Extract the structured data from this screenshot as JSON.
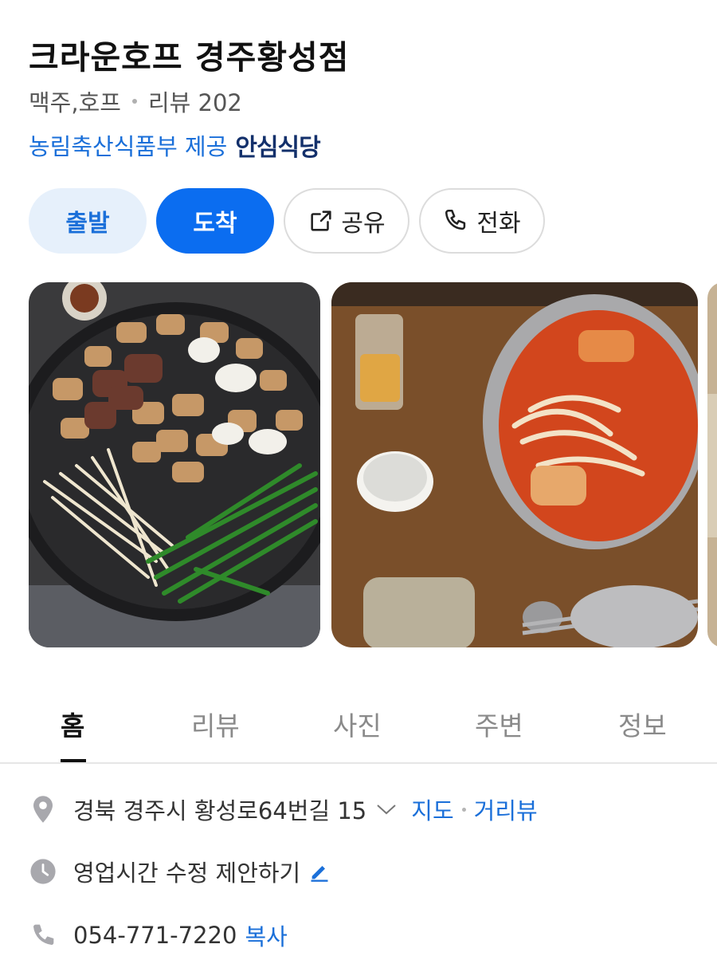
{
  "place": {
    "name": "크라운호프 경주황성점",
    "category": "맥주,호프",
    "review_label": "리뷰 202",
    "gov_provider": "농림축산식품부 제공",
    "gov_badge": "안심식당"
  },
  "actions": {
    "depart": "출발",
    "arrive": "도착",
    "share": "공유",
    "call": "전화"
  },
  "tabs": [
    {
      "label": "홈",
      "active": true
    },
    {
      "label": "리뷰"
    },
    {
      "label": "사진"
    },
    {
      "label": "주변"
    },
    {
      "label": "정보"
    }
  ],
  "info": {
    "address": "경북 경주시 황성로64번길 15",
    "map_link": "지도",
    "roadview_link": "거리뷰",
    "hours": "영업시간 수정 제안하기",
    "phone": "054-771-7220",
    "copy": "복사"
  },
  "colors": {
    "accent": "#0b6df0",
    "link": "#1a6fd9",
    "depart_bg": "#e6f0fb"
  }
}
